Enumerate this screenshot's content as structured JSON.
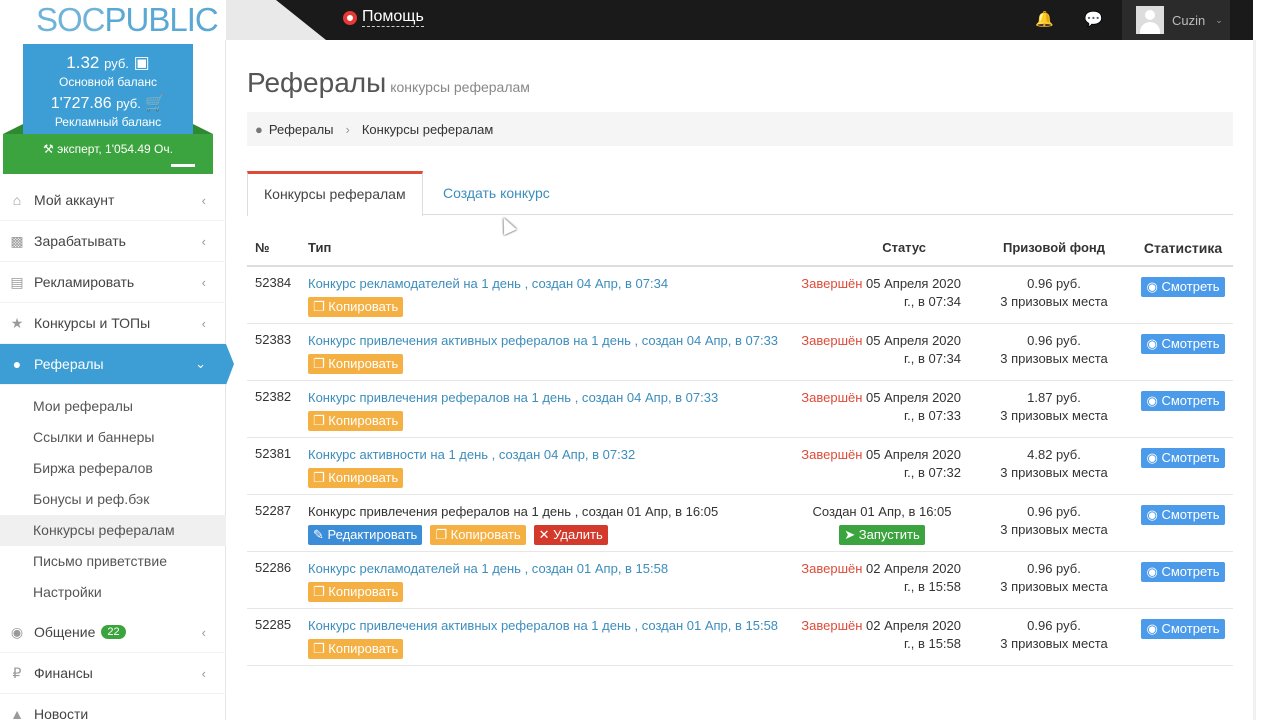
{
  "logo": {
    "part1": "SOC",
    "part2": "PUBLIC"
  },
  "topbar": {
    "help_label": "Помощь",
    "user_name": "Cuzin"
  },
  "balance": {
    "main_value": "1.32",
    "currency": "руб.",
    "main_label": "Основной баланс",
    "ad_value": "1'727.86",
    "ad_label": "Рекламный баланс",
    "expert_label": "эксперт, 1'054.49 Оч."
  },
  "sidebar": {
    "items": [
      {
        "label": "Мой аккаунт"
      },
      {
        "label": "Зарабатывать"
      },
      {
        "label": "Рекламировать"
      },
      {
        "label": "Конкурсы и ТОПы"
      },
      {
        "label": "Рефералы"
      },
      {
        "label": "Общение",
        "badge": "22"
      },
      {
        "label": "Финансы"
      },
      {
        "label": "Новости"
      }
    ],
    "sub_items": [
      {
        "label": "Мои рефералы"
      },
      {
        "label": "Ссылки и баннеры"
      },
      {
        "label": "Биржа рефералов"
      },
      {
        "label": "Бонусы и реф.бэк"
      },
      {
        "label": "Конкурсы рефералам"
      },
      {
        "label": "Письмо приветствие"
      },
      {
        "label": "Настройки"
      }
    ]
  },
  "page": {
    "title": "Рефералы",
    "subtitle": "конкурсы рефералам"
  },
  "breadcrumb": {
    "root": "Рефералы",
    "current": "Конкурсы рефералам"
  },
  "tabs": [
    {
      "label": "Конкурсы рефералам"
    },
    {
      "label": "Создать конкурс"
    }
  ],
  "table": {
    "headers": {
      "num": "№",
      "type": "Тип",
      "status": "Статус",
      "fund": "Призовой фонд",
      "stats": "Статистика"
    },
    "buttons": {
      "copy": "Копировать",
      "view": "Смотреть",
      "edit": "Редактировать",
      "delete": "Удалить",
      "start": "Запустить"
    },
    "rows": [
      {
        "num": "52384",
        "type": "Конкурс рекламодателей на 1 день , создан 04 Апр, в 07:34",
        "status_word": "Завершён",
        "status_date": "05 Апреля 2020 г., в 07:34",
        "fund": "0.96 руб.",
        "places": "3 призовых места"
      },
      {
        "num": "52383",
        "type": "Конкурс привлечения активных рефералов на 1 день , создан 04 Апр, в 07:33",
        "status_word": "Завершён",
        "status_date": "05 Апреля 2020 г., в 07:34",
        "fund": "0.96 руб.",
        "places": "3 призовых места"
      },
      {
        "num": "52382",
        "type": "Конкурс привлечения рефералов на 1 день , создан 04 Апр, в 07:33",
        "status_word": "Завершён",
        "status_date": "05 Апреля 2020 г., в 07:33",
        "fund": "1.87 руб.",
        "places": "3 призовых места"
      },
      {
        "num": "52381",
        "type": "Конкурс активности на 1 день , создан 04 Апр, в 07:32",
        "status_word": "Завершён",
        "status_date": "05 Апреля 2020 г., в 07:32",
        "fund": "4.82 руб.",
        "places": "3 призовых места"
      },
      {
        "num": "52287",
        "type": "Конкурс привлечения рефералов на 1 день , создан 01 Апр, в 16:05",
        "status_created": "Создан 01 Апр, в 16:05",
        "fund": "0.96 руб.",
        "places": "3 призовых места"
      },
      {
        "num": "52286",
        "type": "Конкурс рекламодателей на 1 день , создан 01 Апр, в 15:58",
        "status_word": "Завершён",
        "status_date": "02 Апреля 2020 г., в 15:58",
        "fund": "0.96 руб.",
        "places": "3 призовых места"
      },
      {
        "num": "52285",
        "type": "Конкурс привлечения активных рефералов на 1 день , создан 01 Апр, в 15:58",
        "status_word": "Завершён",
        "status_date": "02 Апреля 2020 г., в 15:58",
        "fund": "0.96 руб.",
        "places": "3 призовых места"
      }
    ]
  },
  "colors": {
    "accent": "#3c9ed4",
    "green": "#3ba43e",
    "warning": "#f5b043",
    "danger": "#dd4b39"
  }
}
